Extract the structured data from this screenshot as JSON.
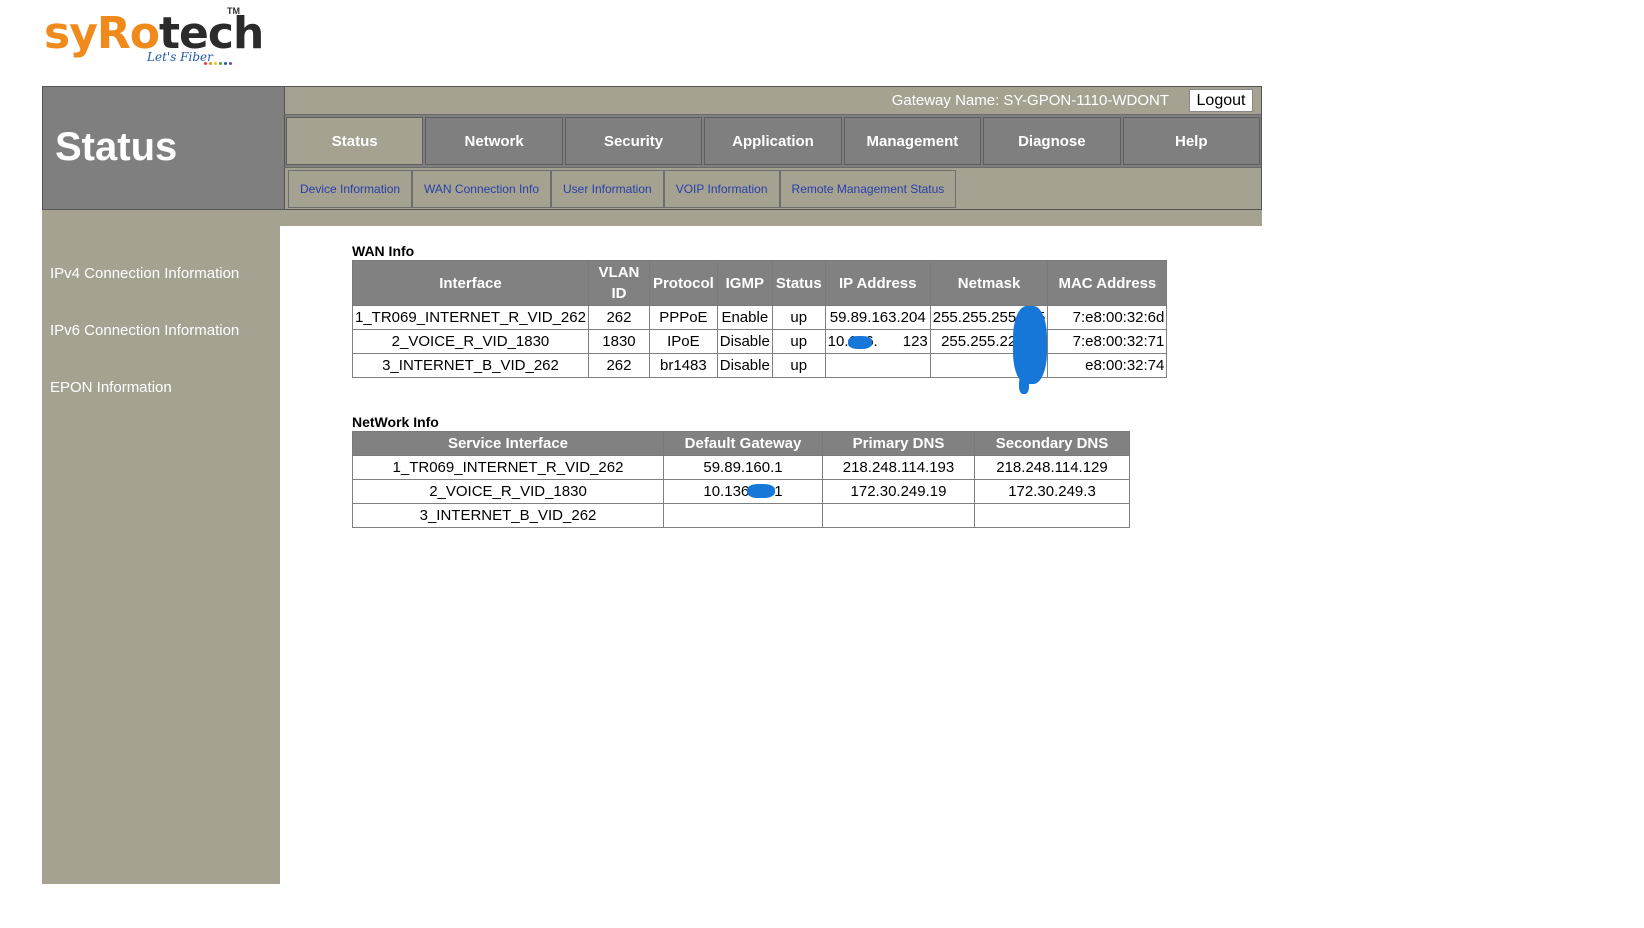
{
  "brand": {
    "name_part1": "sy",
    "name_part2": "Ro",
    "name_part3": "tech",
    "trademark": "TM",
    "tagline": "Let's Fiber",
    "dot_colors": [
      "#e23b3b",
      "#f08a1c",
      "#f2c31b",
      "#3aa14a",
      "#1f5aa8",
      "#7a3fb0"
    ]
  },
  "header": {
    "page_title": "Status",
    "gateway_label": "Gateway Name: SY-GPON-1110-WDONT",
    "logout_label": "Logout"
  },
  "main_nav": {
    "active": "Status",
    "tabs": [
      "Status",
      "Network",
      "Security",
      "Application",
      "Management",
      "Diagnose",
      "Help"
    ]
  },
  "sub_nav": {
    "tabs": [
      "Device Information",
      "WAN Connection Info",
      "User Information",
      "VOIP Information",
      "Remote Management Status"
    ]
  },
  "sidebar": {
    "items": [
      "IPv4 Connection Information",
      "IPv6 Connection Information",
      "EPON Information"
    ]
  },
  "wan_info": {
    "title": "WAN Info",
    "headers": [
      "Interface",
      "VLAN ID",
      "Protocol",
      "IGMP",
      "Status",
      "IP Address",
      "Netmask",
      "MAC Address"
    ],
    "rows": [
      [
        "1_TR069_INTERNET_R_VID_262",
        "262",
        "PPPoE",
        "Enable",
        "up",
        "59.89.163.204",
        "255.255.255.255",
        "7:e8:00:32:6d"
      ],
      [
        "2_VOICE_R_VID_1830",
        "1830",
        "IPoE",
        "Disable",
        "up",
        "10.136.      123",
        "255.255.224.0",
        "7:e8:00:32:71"
      ],
      [
        "3_INTERNET_B_VID_262",
        "262",
        "br1483",
        "Disable",
        "up",
        "",
        "",
        "e8:00:32:74"
      ]
    ]
  },
  "network_info": {
    "title": "NetWork Info",
    "headers": [
      "Service Interface",
      "Default Gateway",
      "Primary DNS",
      "Secondary DNS"
    ],
    "rows": [
      [
        "1_TR069_INTERNET_R_VID_262",
        "59.89.160.1",
        "218.248.114.193",
        "218.248.114.129"
      ],
      [
        "2_VOICE_R_VID_1830",
        "10.136      1",
        "172.30.249.19",
        "172.30.249.3"
      ],
      [
        "3_INTERNET_B_VID_262",
        "",
        "",
        ""
      ]
    ]
  },
  "colors": {
    "panel_gray": "#7f7f7f",
    "panel_tan": "#a6a292",
    "link_blue": "#2740a8",
    "redaction_blue": "#1677d9"
  }
}
